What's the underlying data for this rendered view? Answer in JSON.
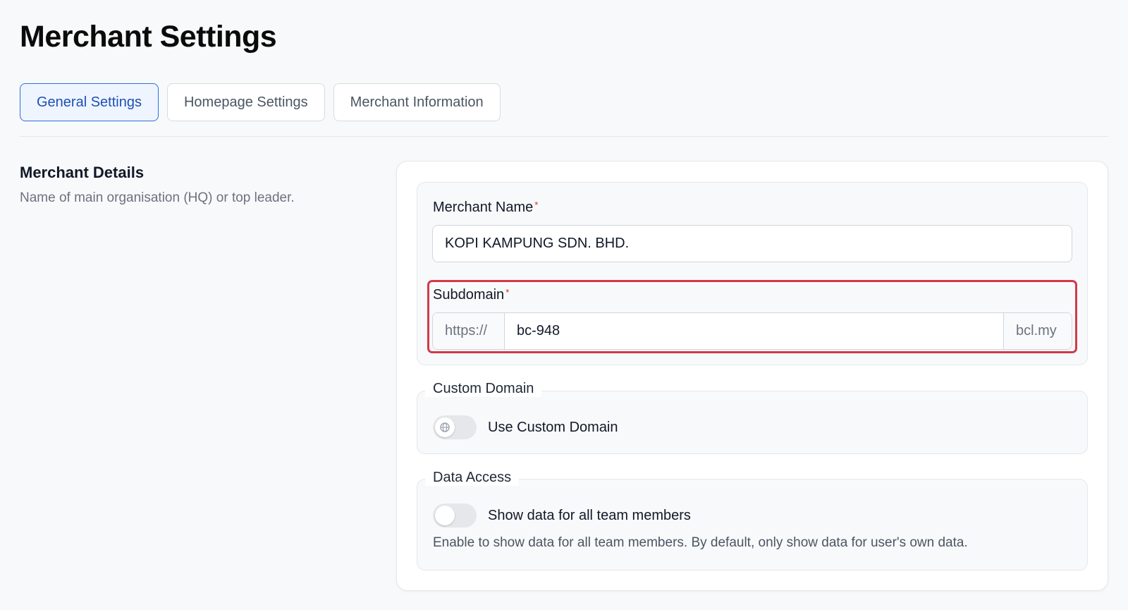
{
  "page": {
    "title": "Merchant Settings"
  },
  "tabs": [
    {
      "label": "General Settings",
      "active": true
    },
    {
      "label": "Homepage Settings",
      "active": false
    },
    {
      "label": "Merchant Information",
      "active": false
    }
  ],
  "section": {
    "heading": "Merchant Details",
    "description": "Name of main organisation (HQ) or top leader."
  },
  "form": {
    "merchant_name": {
      "label": "Merchant Name",
      "required_mark": "*",
      "value": "KOPI KAMPUNG SDN. BHD."
    },
    "subdomain": {
      "label": "Subdomain",
      "required_mark": "*",
      "prefix": "https://",
      "value": "bc-948",
      "suffix": "bcl.my"
    },
    "custom_domain": {
      "legend": "Custom Domain",
      "toggle_label": "Use Custom Domain",
      "enabled": false,
      "knob_icon": "globe-icon"
    },
    "data_access": {
      "legend": "Data Access",
      "toggle_label": "Show data for all team members",
      "enabled": false,
      "help": "Enable to show data for all team members. By default, only show data for user's own data."
    }
  },
  "colors": {
    "accent": "#2f6fe0",
    "highlight": "#d2394b",
    "required": "#dc2626"
  }
}
